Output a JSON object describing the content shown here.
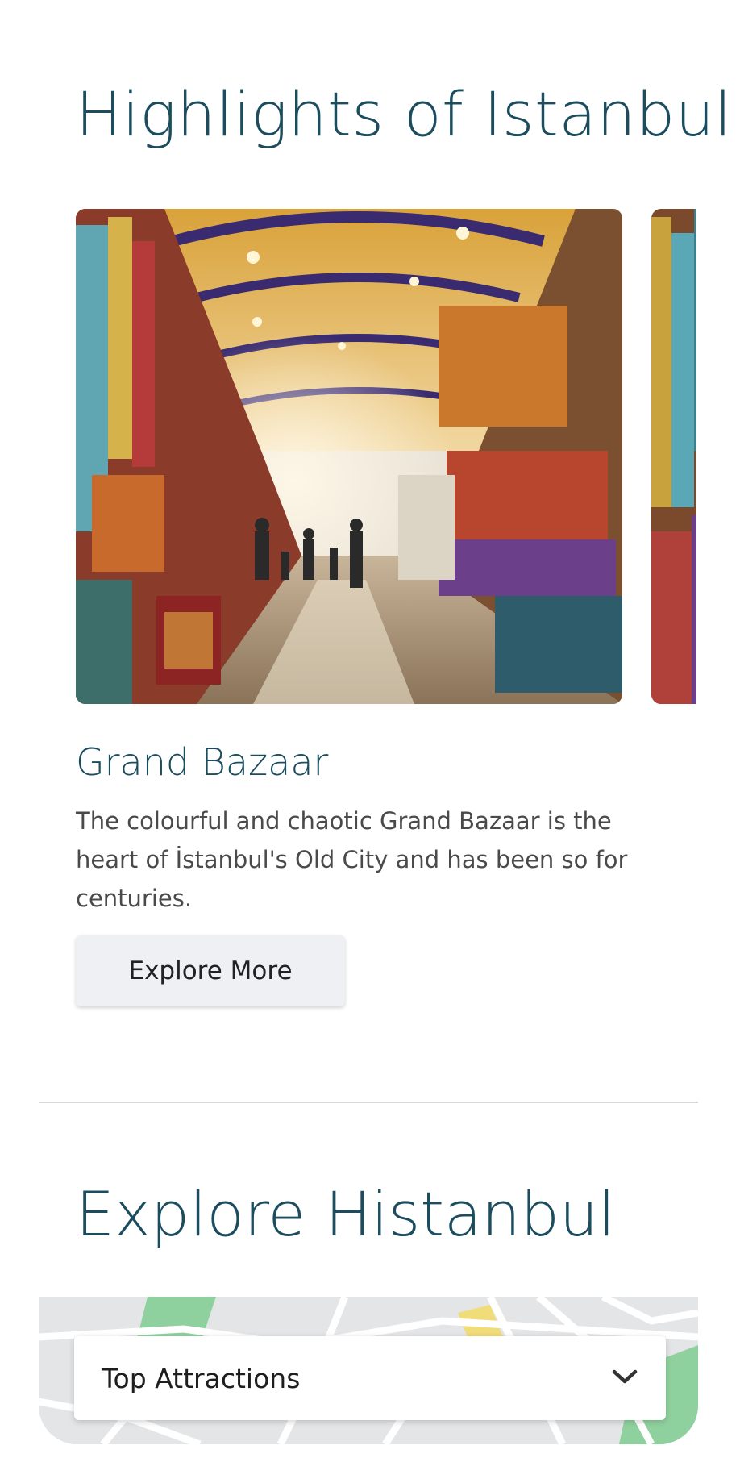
{
  "highlights": {
    "title": "Highlights of Istanbul",
    "cards": [
      {
        "title": "Grand Bazaar",
        "description": "The colourful and chaotic Grand Bazaar is the heart of İstanbul's Old City and has been so for centuries.",
        "button_label": "Explore More"
      }
    ]
  },
  "explore": {
    "title": "Explore Histanbul",
    "dropdown": {
      "selected": "Top Attractions",
      "icon": "chevron-down-icon"
    }
  },
  "colors": {
    "heading": "#1c4d5e",
    "button_bg": "#eef0f4",
    "map_bg": "#e4e5e7",
    "map_park": "#8fd19e"
  }
}
